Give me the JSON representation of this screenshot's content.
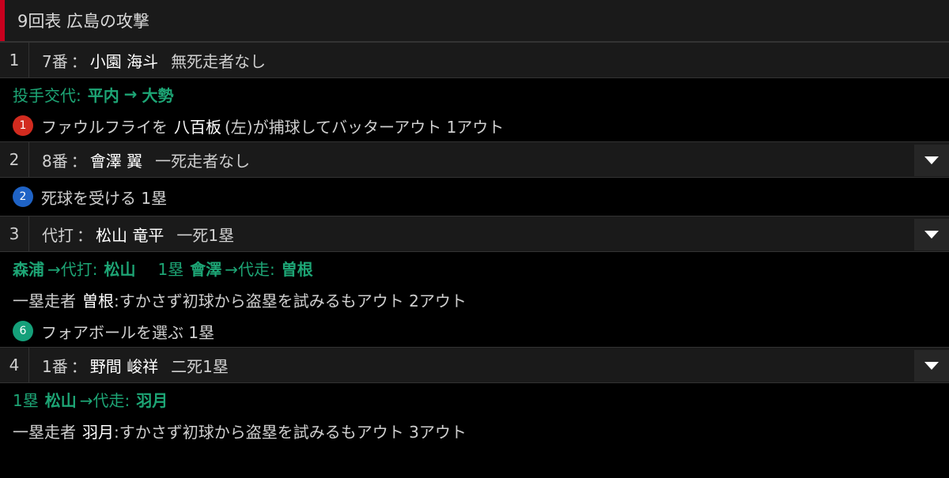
{
  "header": {
    "title": "9回表 広島の攻撃"
  },
  "colors": {
    "accent": "#c8001e",
    "green": "#1da575",
    "out_red": "#d22b1f",
    "blue": "#1f63c6",
    "green_circle": "#15a07a"
  },
  "batters": [
    {
      "num": "1",
      "order": "7番",
      "name": "小園 海斗",
      "situation": "無死走者なし",
      "expandable": false,
      "events": {
        "pitcher_change_label": "投手交代:",
        "pitcher_from": "平内",
        "arrow": "→",
        "pitcher_to": "大勢",
        "result_number": "1",
        "result_text_a": "ファウルフライを",
        "fielder": "八百板",
        "result_text_b": "(左)が捕球してバッターアウト 1アウト"
      }
    },
    {
      "num": "2",
      "order": "8番",
      "name": "會澤 翼",
      "situation": "一死走者なし",
      "expandable": true,
      "events": {
        "result_number": "2",
        "result_text": "死球を受ける 1塁"
      }
    },
    {
      "num": "3",
      "order": "代打",
      "name": "松山 竜平",
      "situation": "一死1塁",
      "expandable": true,
      "events": {
        "sub_from": "森浦",
        "sub_arrow": "→代打:",
        "sub_to": "松山",
        "runner_base": "1塁",
        "runner_from": "會澤",
        "runner_arrow": "→代走:",
        "runner_to": "曽根",
        "steal_prefix": "一塁走者",
        "steal_runner": "曽根",
        "steal_text": ":すかさず初球から盗塁を試みるもアウト 2アウト",
        "result_number": "6",
        "result_text": "フォアボールを選ぶ 1塁"
      }
    },
    {
      "num": "4",
      "order": "1番",
      "name": "野間 峻祥",
      "situation": "二死1塁",
      "expandable": true,
      "events": {
        "runner_base": "1塁",
        "runner_from": "松山",
        "runner_arrow": "→代走:",
        "runner_to": "羽月",
        "steal_prefix": "一塁走者",
        "steal_runner": "羽月",
        "steal_text": ":すかさず初球から盗塁を試みるもアウト 3アウト"
      }
    }
  ],
  "separator": "："
}
